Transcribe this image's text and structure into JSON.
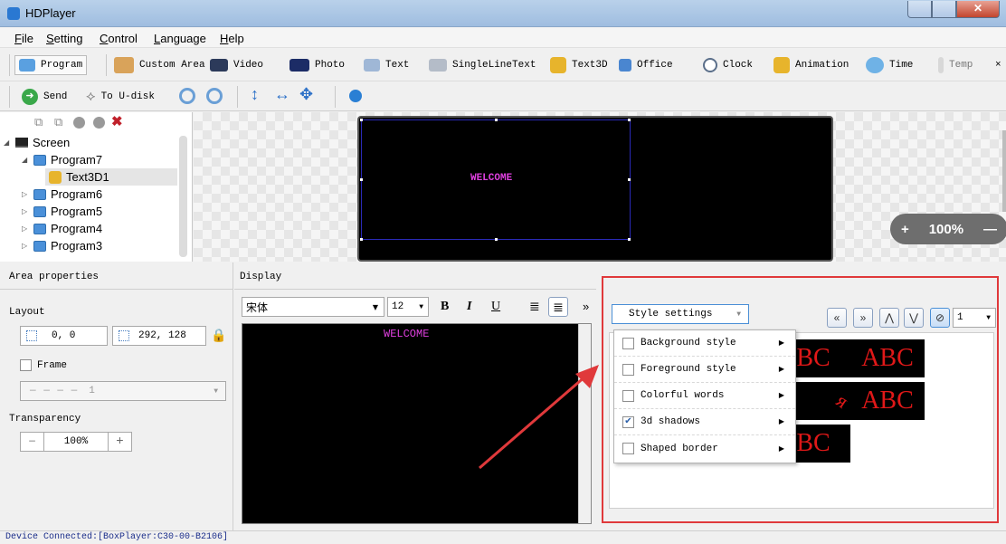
{
  "app": {
    "title": "HDPlayer"
  },
  "menu": [
    {
      "label": "File",
      "u": "F",
      "rest": "ile"
    },
    {
      "label": "Setting",
      "u": "S",
      "rest": "etting"
    },
    {
      "label": "Control",
      "u": "C",
      "rest": "ontrol"
    },
    {
      "label": "Language",
      "u": "L",
      "rest": "anguage"
    },
    {
      "label": "Help",
      "u": "H",
      "rest": "elp"
    }
  ],
  "toolbar1": {
    "program": "Program",
    "custom_area": "Custom Area",
    "video": "Video",
    "photo": "Photo",
    "text": "Text",
    "singleline": "SingleLineText",
    "text3d": "Text3D",
    "office": "Office",
    "clock": "Clock",
    "animation": "Animation",
    "time": "Time",
    "temp": "Temp",
    "overflow": "×"
  },
  "toolbar2": {
    "send": "Send",
    "to_udisk": "To U-disk"
  },
  "tree": {
    "root": "Screen",
    "items": [
      "Program7",
      "Text3D1",
      "Program6",
      "Program5",
      "Program4",
      "Program3"
    ]
  },
  "canvas": {
    "welcome": "WELCOME",
    "zoom_minus": "—",
    "zoom_plus": "+",
    "zoom_value": "100%"
  },
  "area_properties": {
    "title": "Area properties",
    "layout_label": "Layout",
    "position": "0, 0",
    "size": "292, 128",
    "frame_label": "Frame",
    "frame_value": "1",
    "transparency_label": "Transparency",
    "transparency_value": "100%",
    "minus": "—",
    "plus": "+"
  },
  "display": {
    "title": "Display",
    "font": "宋体",
    "size": "12",
    "bold": "B",
    "italic": "I",
    "underline": "U",
    "more": "»",
    "editor_text": "WELCOME"
  },
  "style": {
    "select_label": "Style settings",
    "options": [
      {
        "label": "Background style",
        "checked": false
      },
      {
        "label": "Foreground style",
        "checked": false
      },
      {
        "label": "Colorful words",
        "checked": false
      },
      {
        "label": "3d shadows",
        "checked": true
      },
      {
        "label": "Shaped border",
        "checked": false
      }
    ],
    "nav": [
      "«",
      "»",
      "⋀",
      "⋁",
      "⊘"
    ],
    "page_select": "1",
    "previews": [
      "BC",
      "ABC",
      "ABC",
      "ABC",
      "BC"
    ]
  },
  "status": {
    "text": "Device Connected:[BoxPlayer:C30-00-B2106]"
  },
  "colors": {
    "accent_red": "#e0393b",
    "magenta": "#e040e0",
    "preview_red": "#e01818"
  }
}
